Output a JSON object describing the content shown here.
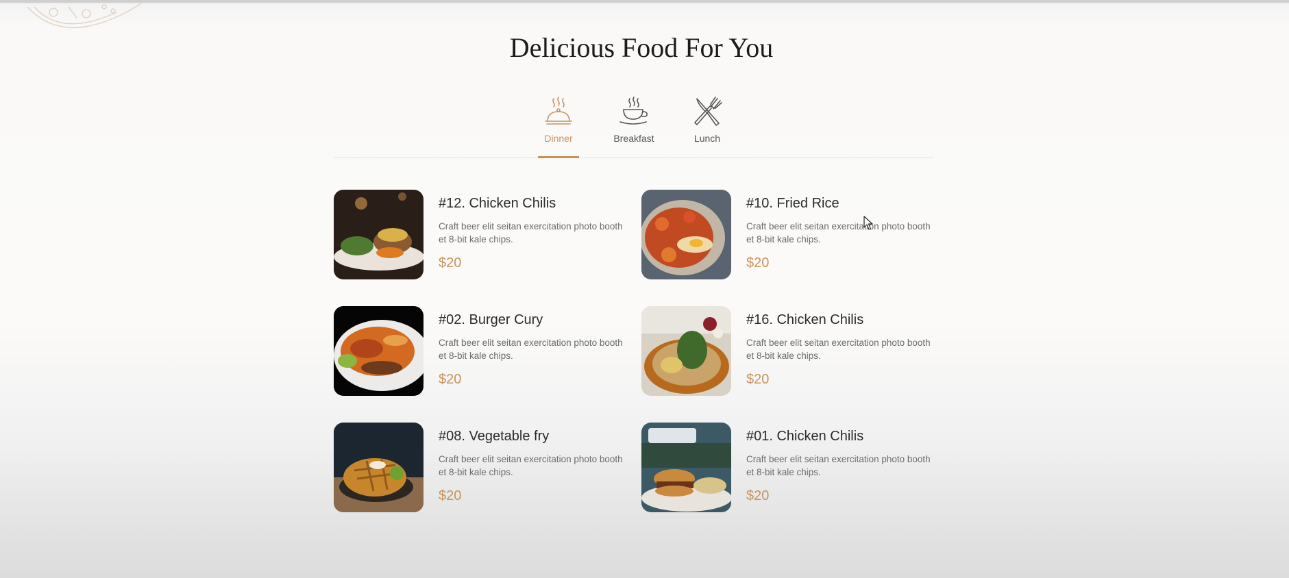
{
  "page": {
    "title": "Delicious Food For You"
  },
  "colors": {
    "accent": "#c8935b",
    "heading": "#1b1b1b",
    "text": "#6b6b6b"
  },
  "tabs": [
    {
      "label": "Dinner",
      "icon": "cloche-icon",
      "active": true
    },
    {
      "label": "Breakfast",
      "icon": "coffee-cup-icon",
      "active": false
    },
    {
      "label": "Lunch",
      "icon": "fork-knife-icon",
      "active": false
    }
  ],
  "menu": [
    {
      "name": "#12. Chicken Chilis",
      "description": "Craft beer elit seitan exercitation photo booth et 8-bit kale chips.",
      "price": "$20"
    },
    {
      "name": "#10. Fried Rice",
      "description": "Craft beer elit seitan exercitation photo booth et 8-bit kale chips.",
      "price": "$20"
    },
    {
      "name": "#02. Burger Cury",
      "description": "Craft beer elit seitan exercitation photo booth et 8-bit kale chips.",
      "price": "$20"
    },
    {
      "name": "#16. Chicken Chilis",
      "description": "Craft beer elit seitan exercitation photo booth et 8-bit kale chips.",
      "price": "$20"
    },
    {
      "name": "#08. Vegetable fry",
      "description": "Craft beer elit seitan exercitation photo booth et 8-bit kale chips.",
      "price": "$20"
    },
    {
      "name": "#01. Chicken Chilis",
      "description": "Craft beer elit seitan exercitation photo booth et 8-bit kale chips.",
      "price": "$20"
    }
  ]
}
